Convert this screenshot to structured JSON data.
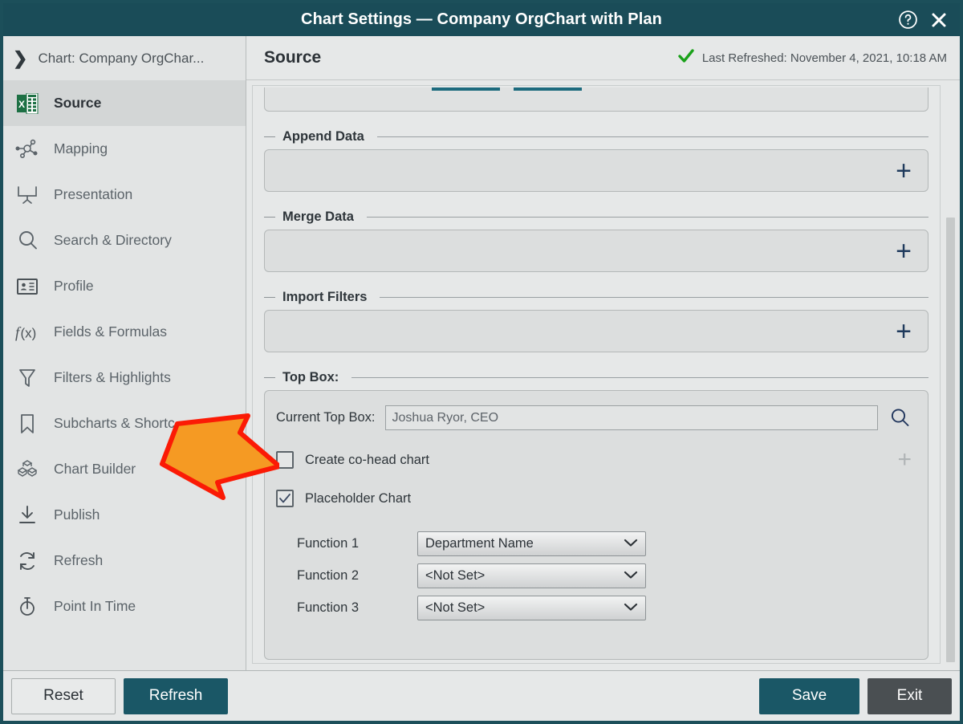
{
  "window": {
    "title": "Chart Settings — Company OrgChart with Plan",
    "help_icon": "help-circle-icon",
    "close_icon": "close-icon"
  },
  "sidebar": {
    "breadcrumb": "Chart: Company OrgChar...",
    "items": [
      {
        "label": "Source",
        "icon": "excel-file-icon",
        "active": true
      },
      {
        "label": "Mapping",
        "icon": "node-graph-icon",
        "active": false
      },
      {
        "label": "Presentation",
        "icon": "projector-screen-icon",
        "active": false
      },
      {
        "label": "Search & Directory",
        "icon": "search-icon",
        "active": false
      },
      {
        "label": "Profile",
        "icon": "id-card-icon",
        "active": false
      },
      {
        "label": "Fields & Formulas",
        "icon": "function-icon",
        "active": false
      },
      {
        "label": "Filters & Highlights",
        "icon": "funnel-icon",
        "active": false
      },
      {
        "label": "Subcharts & Shortc",
        "icon": "bookmark-icon",
        "active": false
      },
      {
        "label": "Chart Builder",
        "icon": "blocks-icon",
        "active": false
      },
      {
        "label": "Publish",
        "icon": "download-icon",
        "active": false
      },
      {
        "label": "Refresh",
        "icon": "refresh-icon",
        "active": false
      },
      {
        "label": "Point In Time",
        "icon": "stopwatch-icon",
        "active": false
      }
    ]
  },
  "main": {
    "title": "Source",
    "refresh_status": "Last Refreshed: November 4, 2021, 10:18 AM",
    "status_icon": "green-check-icon",
    "groups": [
      {
        "legend": "Append Data",
        "add_icon": "plus-icon"
      },
      {
        "legend": "Merge Data",
        "add_icon": "plus-icon"
      },
      {
        "legend": "Import Filters",
        "add_icon": "plus-icon"
      }
    ],
    "top_box": {
      "legend": "Top Box:",
      "current_label": "Current Top Box:",
      "current_value": "Joshua Ryor, CEO",
      "search_icon": "magnifier-icon",
      "checkboxes": [
        {
          "label": "Create co-head chart",
          "checked": false
        },
        {
          "label": "Placeholder Chart",
          "checked": true
        }
      ],
      "add_icon": "plus-icon-disabled",
      "functions": [
        {
          "label": "Function 1",
          "value": "Department Name"
        },
        {
          "label": "Function 2",
          "value": "<Not Set>"
        },
        {
          "label": "Function 3",
          "value": "<Not Set>"
        }
      ]
    }
  },
  "footer": {
    "reset": "Reset",
    "refresh": "Refresh",
    "save": "Save",
    "exit": "Exit"
  },
  "annotation": {
    "shape": "orange-arrow-pointing-right",
    "fill": "#F59A23",
    "stroke": "#FB1A05"
  },
  "colors": {
    "titlebar": "#1a4c58",
    "accent": "#1a5766",
    "panel_bg": "#e6e8e8",
    "sidebar_bg": "#e2e4e4",
    "status_check": "#1aa11a",
    "exit_btn": "#4a4f52"
  }
}
